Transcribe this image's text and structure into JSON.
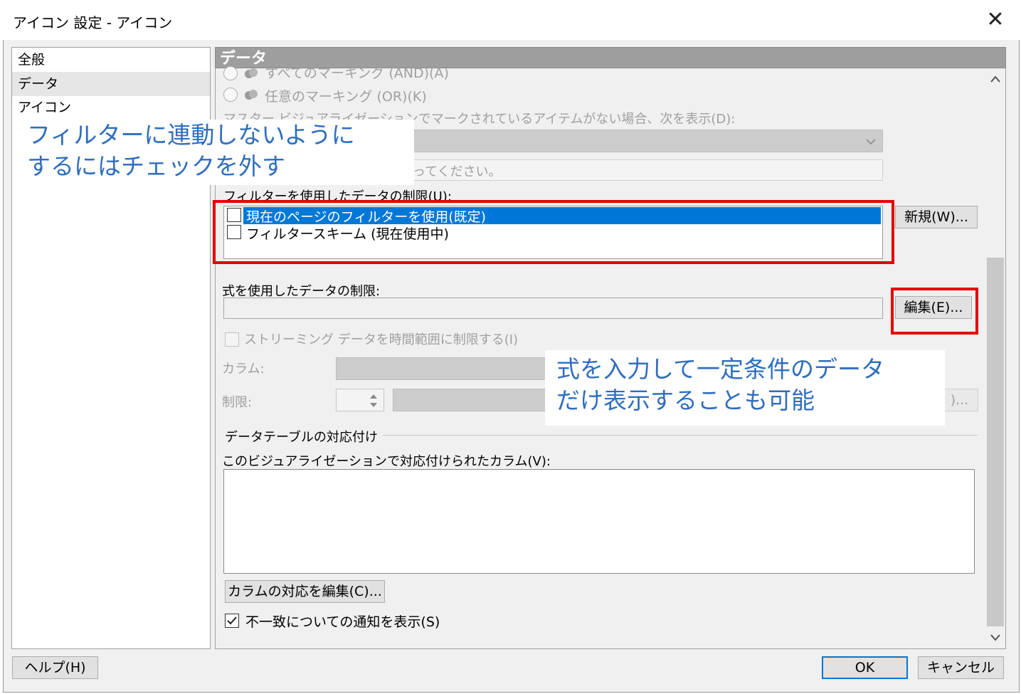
{
  "window": {
    "title": "アイコン 設定 - アイコン",
    "close_glyph": "✕"
  },
  "nav": {
    "items": [
      {
        "label": "全般"
      },
      {
        "label": "データ"
      },
      {
        "label": "アイコン"
      }
    ],
    "selected": "データ"
  },
  "section": {
    "title": "データ"
  },
  "marking": {
    "radio_and": "すべてのマーキング (AND)(A)",
    "radio_or": "任意のマーキング (OR)(K)",
    "empty_label": "マスター ビジュアライゼーションでマークされているアイテムがない場合、次を表示(D):",
    "empty_dropdown_value": "",
    "hint_tail": "ってください。"
  },
  "filter": {
    "label": "フィルターを使用したデータの制限(U):",
    "options": [
      {
        "label": "現在のページのフィルターを使用(既定)",
        "checked": false,
        "selected": true
      },
      {
        "label": "フィルタースキーム (現在使用中)",
        "checked": false,
        "selected": false
      }
    ],
    "new_button": "新規(W)..."
  },
  "expression": {
    "label": "式を使用したデータの制限:",
    "value": "",
    "edit_button": "編集(E)..."
  },
  "streaming": {
    "checkbox_label": "ストリーミング データを時間範囲に制限する(I)",
    "column_label": "カラム:",
    "limit_label": "制限:",
    "button_tail": ")..."
  },
  "datatable": {
    "group_title": "データテーブルの対応付け",
    "columns_label": "このビジュアライゼーションで対応付けられたカラム(V):",
    "edit_button": "カラムの対応を編集(C)...",
    "notify_label": "不一致についての通知を表示(S)",
    "notify_checked": true
  },
  "callouts": {
    "left_line1": "フィルターに連動しないように",
    "left_line2": "するにはチェックを外す",
    "right_line1": "式を入力して一定条件のデータ",
    "right_line2": "だけ表示することも可能"
  },
  "footer": {
    "help": "ヘルプ(H)",
    "ok": "OK",
    "cancel": "キャンセル"
  },
  "colors": {
    "selection": "#0078d7",
    "highlight_red": "#e60000",
    "callout_text": "#2f6ebd",
    "section_bar": "#9e9e9e"
  }
}
